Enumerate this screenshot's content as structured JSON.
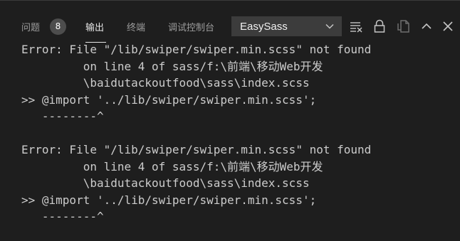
{
  "panel": {
    "tabs": [
      {
        "label": "问题",
        "active": false
      },
      {
        "label": "输出",
        "active": true
      },
      {
        "label": "终端",
        "active": false
      },
      {
        "label": "调试控制台",
        "active": false
      }
    ],
    "problems_count": "8",
    "channel_select": {
      "value": "EasySass"
    },
    "toolbar_icons": [
      "clear-output-icon",
      "lock-icon",
      "open-in-editor-icon",
      "maximize-panel-icon",
      "close-panel-icon"
    ],
    "colors": {
      "background": "#1e1e1e",
      "text": "#cccccc",
      "badge": "#4d4d4d",
      "select_bg": "#3c3c3c"
    }
  },
  "output": {
    "lines": [
      "Error: File \"/lib/swiper/swiper.min.scss\" not found",
      "         on line 4 of sass/f:\\前端\\移动Web开发",
      "         \\baidutackoutfood\\sass\\index.scss",
      ">> @import '../lib/swiper/swiper.min.scss';",
      "   --------^",
      "",
      "Error: File \"/lib/swiper/swiper.min.scss\" not found",
      "         on line 4 of sass/f:\\前端\\移动Web开发",
      "         \\baidutackoutfood\\sass\\index.scss",
      ">> @import '../lib/swiper/swiper.min.scss';",
      "   --------^"
    ]
  }
}
